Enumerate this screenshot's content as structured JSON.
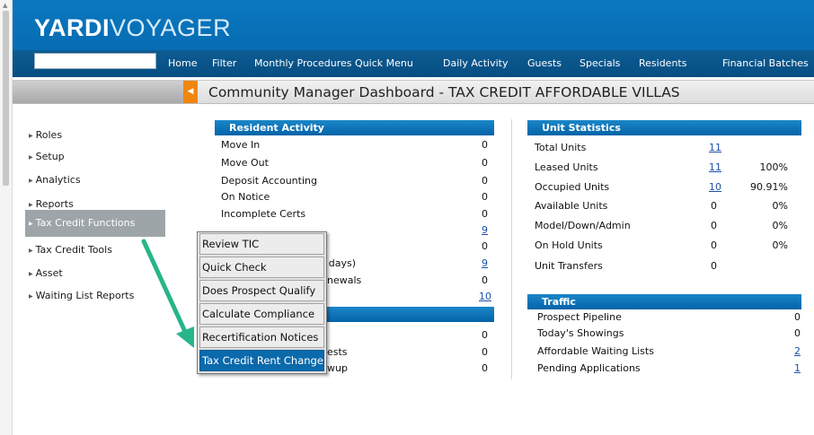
{
  "header": {
    "brand_bold": "YARDI",
    "brand_light": "VOYAGER",
    "nav": [
      "Home",
      "Filter",
      "Monthly Procedures Quick Menu",
      "Daily Activity",
      "Guests",
      "Specials",
      "Residents",
      "Financial Batches"
    ]
  },
  "page_title": "Community Manager Dashboard - TAX CREDIT AFFORDABLE VILLAS",
  "sidebar": {
    "items": [
      "Roles",
      "Setup",
      "Analytics",
      "Reports",
      "Tax Credit Functions",
      "Tax Credit Tools",
      "Asset",
      "Waiting List Reports"
    ],
    "active": "Tax Credit Functions"
  },
  "resident_activity": {
    "title": "Resident Activity",
    "rows": [
      {
        "label": "Move In",
        "value": "0"
      },
      {
        "label": "Move Out",
        "value": "0"
      },
      {
        "label": "Deposit Accounting",
        "value": "0"
      },
      {
        "label": "On Notice",
        "value": "0"
      },
      {
        "label": "Incomplete Certs",
        "value": "0"
      },
      {
        "label": "",
        "value": "9"
      },
      {
        "label": "",
        "value": "0"
      },
      {
        "label": ") days)",
        "value": "9"
      },
      {
        "label": "newals",
        "value": "0"
      },
      {
        "label": "",
        "value": "10"
      }
    ]
  },
  "lower_left": {
    "rows": [
      {
        "label": "",
        "value": "0"
      },
      {
        "label": "ests",
        "value": "0"
      },
      {
        "label": "wup",
        "value": "0"
      }
    ]
  },
  "unit_statistics": {
    "title": "Unit Statistics",
    "rows": [
      {
        "label": "Total Units",
        "value": "11",
        "pct": ""
      },
      {
        "label": "Leased Units",
        "value": "11",
        "pct": "100%"
      },
      {
        "label": "Occupied Units",
        "value": "10",
        "pct": "90.91%"
      },
      {
        "label": "Available Units",
        "value": "0",
        "pct": "0%"
      },
      {
        "label": "Model/Down/Admin",
        "value": "0",
        "pct": "0%"
      },
      {
        "label": "On Hold Units",
        "value": "0",
        "pct": "0%"
      },
      {
        "label": "Unit Transfers",
        "value": "0",
        "pct": ""
      }
    ]
  },
  "traffic": {
    "title": "Traffic",
    "rows": [
      {
        "label": "Prospect Pipeline",
        "value": "0"
      },
      {
        "label": "Today's Showings",
        "value": "0"
      },
      {
        "label": "Affordable Waiting Lists",
        "value": "2"
      },
      {
        "label": "Pending Applications",
        "value": "1"
      }
    ]
  },
  "dropdown": {
    "items": [
      "Review TIC",
      "Quick Check",
      "Does Prospect Qualify",
      "Calculate Compliance",
      "Recertification Notices",
      "Tax Credit Rent Change"
    ],
    "selected": "Tax Credit Rent Change"
  },
  "colors": {
    "header_blue": "#0a78bf",
    "panel_blue": "#0563a8",
    "collapse_orange": "#f0860e",
    "arrow_green": "#27b58a",
    "link_blue": "#1a4fa8"
  },
  "icons": {
    "collapse": "chevron-left-icon",
    "sidebar_caret": "caret-right-icon",
    "annotation": "green-arrow-icon"
  }
}
